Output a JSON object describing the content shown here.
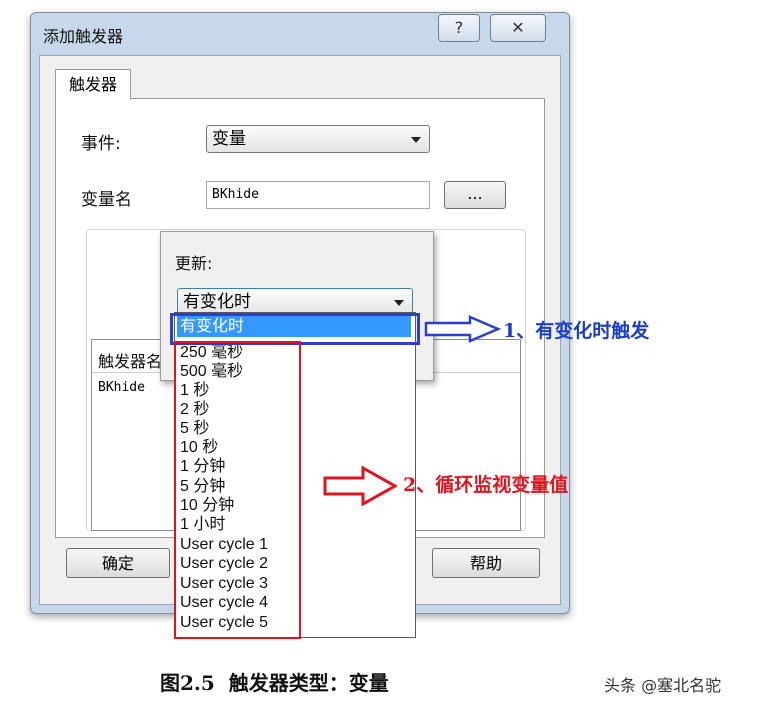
{
  "dialog": {
    "title": "添加触发器",
    "help_glyph": "?",
    "close_glyph": "✕",
    "tab_label": "触发器",
    "event_label": "事件:",
    "event_value": "变量",
    "varname_label": "变量名",
    "varname_value": "BKhide",
    "browse_label": "...",
    "list_header": "触发器名",
    "list_row": "BKhide",
    "ok_label": "确定",
    "help_label": "帮助"
  },
  "popup": {
    "update_label": "更新:",
    "selected": "有变化时",
    "options": [
      "有变化时",
      "250 毫秒",
      "500 毫秒",
      "1 秒",
      "2 秒",
      "5 秒",
      "10 秒",
      "1 分钟",
      "5 分钟",
      "10 分钟",
      "1 小时",
      "User cycle 1",
      "User cycle 2",
      "User cycle 3",
      "User cycle 4",
      "User cycle 5"
    ]
  },
  "annotations": {
    "note1": "1、有变化时触发",
    "note2": "2、循环监视变量值",
    "note1_color": "#1a3fc4",
    "note2_color": "#e0141e"
  },
  "caption": "图2.5  触发器类型：变量",
  "watermark": "头条 @塞北名驼"
}
